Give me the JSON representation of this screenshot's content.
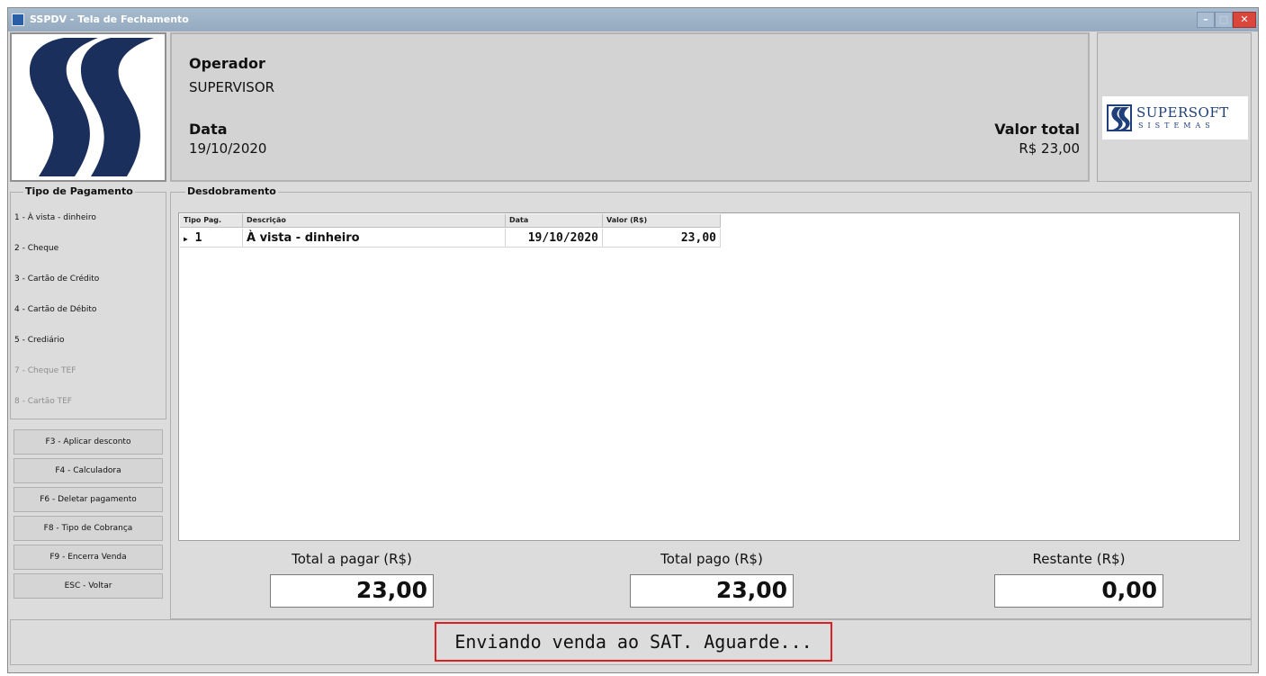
{
  "window": {
    "title": "SSPDV - Tela de Fechamento"
  },
  "header": {
    "operador_label": "Operador",
    "operador_value": "SUPERVISOR",
    "data_label": "Data",
    "data_value": "19/10/2020",
    "valor_total_label": "Valor total",
    "valor_total_value": "R$ 23,00"
  },
  "brand": {
    "name": "SUPERSOFT",
    "sub": "SISTEMAS",
    "color": "#1f3f7a"
  },
  "payment_types": {
    "title": "Tipo de Pagamento",
    "items": [
      {
        "label": "1 - À vista - dinheiro",
        "enabled": true
      },
      {
        "label": "2 - Cheque",
        "enabled": true
      },
      {
        "label": "3 - Cartão de Crédito",
        "enabled": true
      },
      {
        "label": "4 - Cartão de Débito",
        "enabled": true
      },
      {
        "label": "5 - Crediário",
        "enabled": true
      },
      {
        "label": "7 - Cheque TEF",
        "enabled": false
      },
      {
        "label": "8 - Cartão TEF",
        "enabled": false
      }
    ]
  },
  "function_buttons": [
    "F3 - Aplicar desconto",
    "F4 - Calculadora",
    "F6 - Deletar pagamento",
    "F8 - Tipo de Cobrança",
    "F9 - Encerra Venda",
    "ESC - Voltar"
  ],
  "desdobramento": {
    "title": "Desdobramento",
    "columns": [
      "Tipo Pag.",
      "Descrição",
      "Data",
      "Valor (R$)"
    ],
    "rows": [
      {
        "tipo": "1",
        "descricao": "À vista - dinheiro",
        "data": "19/10/2020",
        "valor": "23,00"
      }
    ]
  },
  "totals": {
    "a_pagar_label": "Total a pagar (R$)",
    "a_pagar_value": "23,00",
    "pago_label": "Total pago (R$)",
    "pago_value": "23,00",
    "restante_label": "Restante (R$)",
    "restante_value": "0,00"
  },
  "status": {
    "message": "Enviando venda ao SAT. Aguarde...",
    "border_color": "#e02020"
  }
}
